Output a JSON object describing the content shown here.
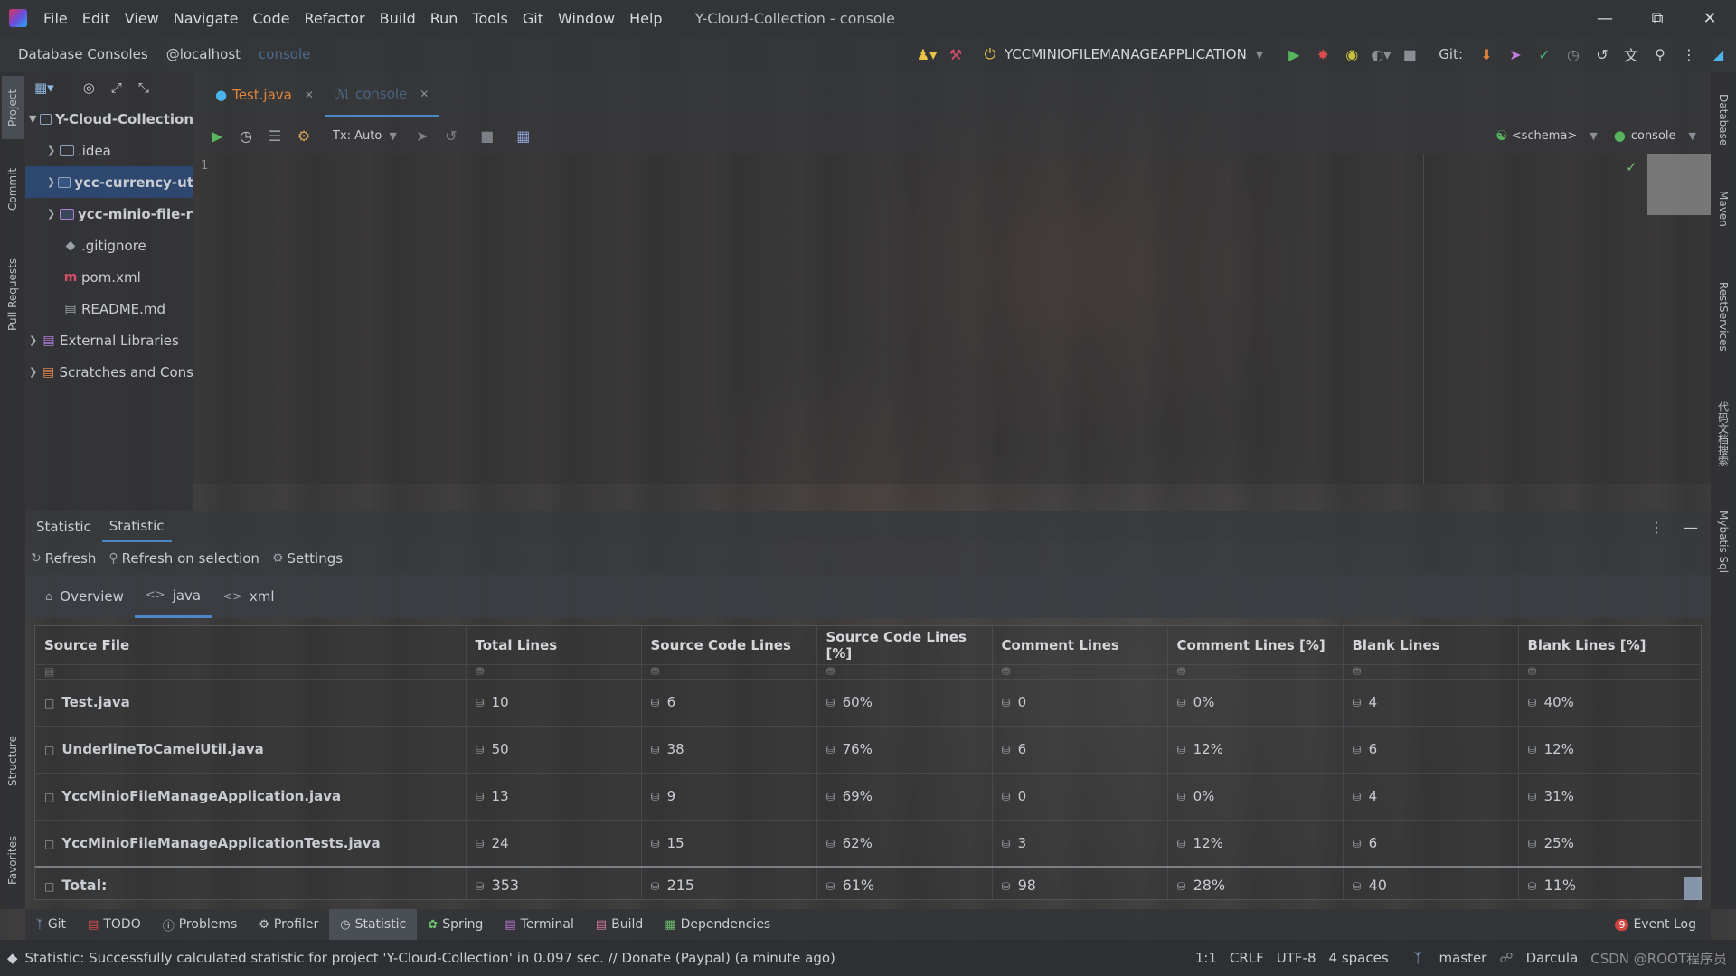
{
  "menu": {
    "items": [
      "File",
      "Edit",
      "View",
      "Navigate",
      "Code",
      "Refactor",
      "Build",
      "Run",
      "Tools",
      "Git",
      "Window",
      "Help"
    ],
    "window_title": "Y-Cloud-Collection - console"
  },
  "navbar": {
    "crumb1": "Database Consoles",
    "crumb2": "@localhost",
    "crumb3": "console",
    "run_config": "YCCMINIOFILEMANAGEAPPLICATION",
    "git_label": "Git:"
  },
  "left_stripe": {
    "project": "Project",
    "commit": "Commit",
    "pull_requests": "Pull Requests",
    "structure": "Structure",
    "favorites": "Favorites"
  },
  "right_stripe": {
    "database": "Database",
    "maven": "Maven",
    "rest": "RestServices",
    "translate": "代码文档搜索",
    "mybatis": "Mybatis Sql"
  },
  "project_tree": [
    {
      "label": "Y-Cloud-Collection",
      "kind": "root"
    },
    {
      "label": ".idea",
      "kind": "folder"
    },
    {
      "label": "ycc-currency-ut",
      "kind": "module"
    },
    {
      "label": "ycc-minio-file-r",
      "kind": "module"
    },
    {
      "label": ".gitignore",
      "kind": "file"
    },
    {
      "label": "pom.xml",
      "kind": "maven"
    },
    {
      "label": "README.md",
      "kind": "file"
    },
    {
      "label": "External Libraries",
      "kind": "lib"
    },
    {
      "label": "Scratches and Cons",
      "kind": "lib"
    }
  ],
  "editor": {
    "tabs": [
      "Test.java",
      "console"
    ],
    "tx_mode": "Tx: Auto",
    "schema": "<schema>",
    "console": "console",
    "line_number": "1"
  },
  "statistic": {
    "header_tabs": [
      "Statistic",
      "Statistic"
    ],
    "actions": {
      "refresh": "Refresh",
      "refresh_selection": "Refresh on selection",
      "settings": "Settings"
    },
    "file_tabs": [
      "Overview",
      "java",
      "xml"
    ],
    "columns": [
      "Source File",
      "Total Lines",
      "Source Code Lines",
      "Source Code Lines [%]",
      "Comment Lines",
      "Comment Lines [%]",
      "Blank Lines",
      "Blank Lines [%]"
    ],
    "rows": [
      [
        "Test.java",
        "10",
        "6",
        "60%",
        "0",
        "0%",
        "4",
        "40%"
      ],
      [
        "UnderlineToCamelUtil.java",
        "50",
        "38",
        "76%",
        "6",
        "12%",
        "6",
        "12%"
      ],
      [
        "YccMinioFileManageApplication.java",
        "13",
        "9",
        "69%",
        "0",
        "0%",
        "4",
        "31%"
      ],
      [
        "YccMinioFileManageApplicationTests.java",
        "24",
        "15",
        "62%",
        "3",
        "12%",
        "6",
        "25%"
      ]
    ],
    "total": [
      "Total:",
      "353",
      "215",
      "61%",
      "98",
      "28%",
      "40",
      "11%"
    ]
  },
  "tool_windows": [
    "Git",
    "TODO",
    "Problems",
    "Profiler",
    "Statistic",
    "Spring",
    "Terminal",
    "Build",
    "Dependencies"
  ],
  "event_log": {
    "label": "Event Log",
    "count": "9"
  },
  "status": {
    "message": "Statistic: Successfully calculated statistic for project 'Y-Cloud-Collection' in 0.097 sec. // Donate (Paypal) (a minute ago)",
    "position": "1:1",
    "line_sep": "CRLF",
    "encoding": "UTF-8",
    "indent": "4 spaces",
    "branch": "master",
    "theme": "Darcula",
    "watermark": "CSDN @ROOT程序员"
  }
}
